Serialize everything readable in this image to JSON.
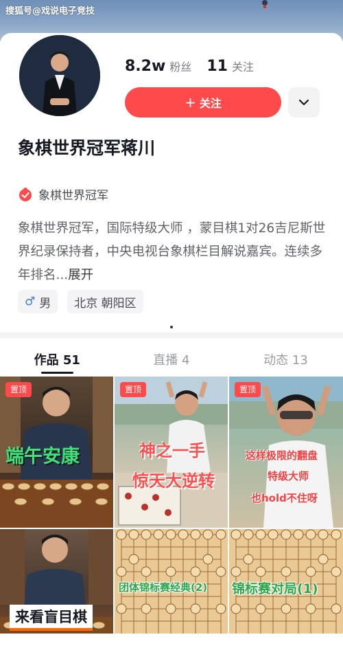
{
  "watermark": "搜狐号@戏说电子竞技",
  "profile": {
    "followers_count": "8.2w",
    "followers_label": "粉丝",
    "following_count": "11",
    "following_label": "关注",
    "follow_button_label": "关注",
    "name": "象棋世界冠军蒋川",
    "verification_label": "象棋世界冠军",
    "bio": "象棋世界冠军，国际特级大师 ，蒙目棋1对26吉尼斯世界纪录保持者，中央电视台象棋栏目解说嘉宾。连续多年排名...",
    "bio_expand": "展开",
    "gender_symbol": "♂",
    "gender": "男",
    "location": "北京 朝阳区"
  },
  "tabs": [
    {
      "label": "作品 51"
    },
    {
      "label": "直播 4"
    },
    {
      "label": "动态 13"
    }
  ],
  "videos": [
    {
      "pin": "置顶",
      "caption": "端午安康"
    },
    {
      "pin": "置顶",
      "caption_line1": "神之一手",
      "caption_line2": "惊天大逆转"
    },
    {
      "pin": "置顶",
      "caption_line1": "这样极限的翻盘",
      "caption_line2": "特级大师",
      "caption_line3": "也hold不住呀"
    },
    {
      "caption": "来看盲目棋"
    },
    {
      "caption": "团体锦标赛经典(2)"
    },
    {
      "caption": "锦标赛对局(1)"
    }
  ],
  "colors": {
    "accent": "#fe4a4a",
    "text_primary": "#161823",
    "text_secondary": "#61636b"
  }
}
